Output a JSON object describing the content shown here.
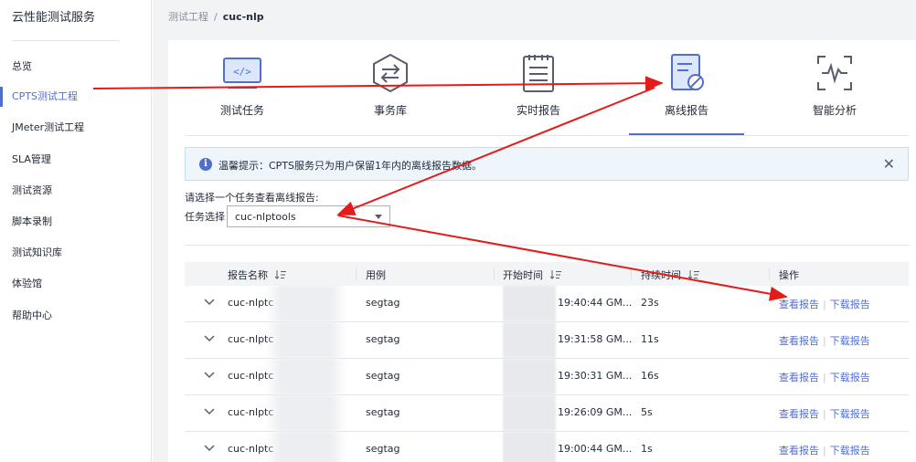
{
  "sidebar": {
    "title": "云性能测试服务",
    "items": [
      {
        "label": "总览"
      },
      {
        "label": "CPTS测试工程"
      },
      {
        "label": "JMeter测试工程"
      },
      {
        "label": "SLA管理"
      },
      {
        "label": "测试资源"
      },
      {
        "label": "脚本录制"
      },
      {
        "label": "测试知识库"
      },
      {
        "label": "体验馆"
      },
      {
        "label": "帮助中心"
      }
    ],
    "active_index": 1
  },
  "breadcrumb": {
    "parent": "测试工程",
    "separator": "/",
    "current": "cuc-nlp"
  },
  "tabs": [
    {
      "label": "测试任务",
      "icon": "code-monitor-icon"
    },
    {
      "label": "事务库",
      "icon": "transaction-hexagon-icon"
    },
    {
      "label": "实时报告",
      "icon": "notepad-icon"
    },
    {
      "label": "离线报告",
      "icon": "report-blocked-icon"
    },
    {
      "label": "智能分析",
      "icon": "waveform-icon"
    }
  ],
  "active_tab": 3,
  "alert": {
    "icon": "info-icon",
    "text": "温馨提示：CPTS服务只为用户保留1年内的离线报告数据。",
    "close": "✕"
  },
  "task_select": {
    "hint": "请选择一个任务查看离线报告:",
    "label": "任务选择",
    "value": "cuc-nlptools"
  },
  "table": {
    "headers": [
      "报告名称",
      "用例",
      "开始时间",
      "持续时间",
      "操作"
    ],
    "rows": [
      {
        "name": "cuc-nlptc",
        "case": "segtag",
        "start": "19:40:44 GM...",
        "duration": "23s",
        "view": "查看报告",
        "download": "下载报告"
      },
      {
        "name": "cuc-nlptc",
        "case": "segtag",
        "start": "19:31:58 GM...",
        "duration": "11s",
        "view": "查看报告",
        "download": "下载报告"
      },
      {
        "name": "cuc-nlptc",
        "case": "segtag",
        "start": "19:30:31 GM...",
        "duration": "16s",
        "view": "查看报告",
        "download": "下载报告"
      },
      {
        "name": "cuc-nlptc",
        "case": "segtag",
        "start": "19:26:09 GM...",
        "duration": "5s",
        "view": "查看报告",
        "download": "下载报告"
      },
      {
        "name": "cuc-nlptc",
        "case": "segtag",
        "start": "19:00:44 GM...",
        "duration": "1s",
        "view": "查看报告",
        "download": "下载报告"
      }
    ]
  },
  "colors": {
    "accent": "#526ecc",
    "annotation": "#e41b1b"
  }
}
